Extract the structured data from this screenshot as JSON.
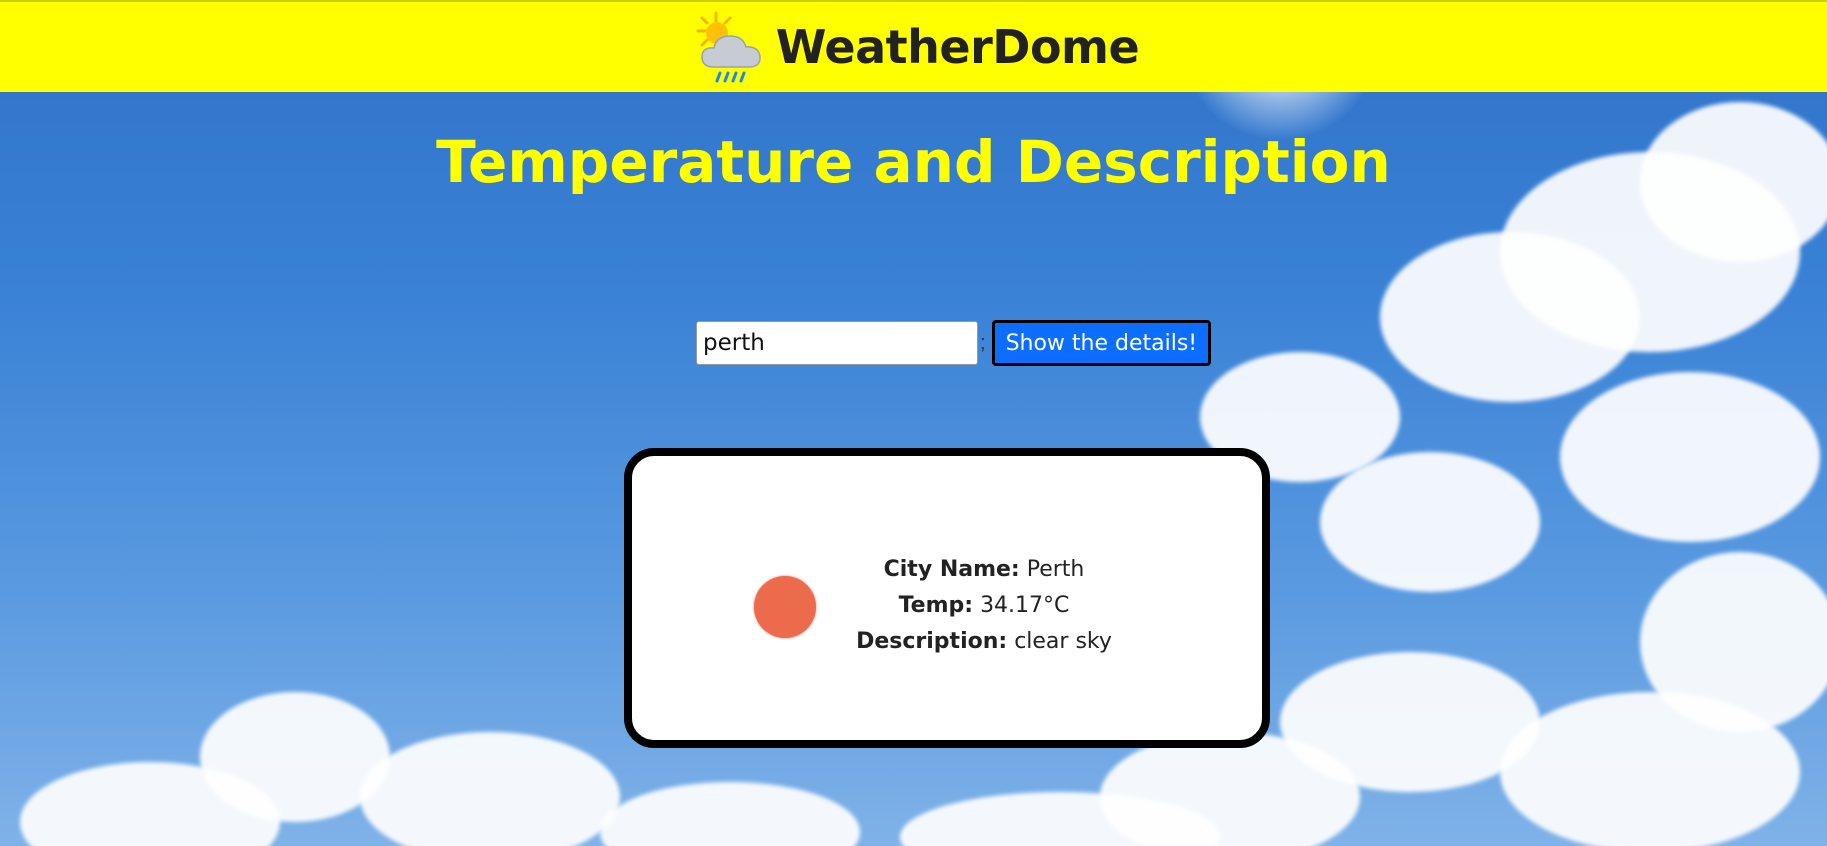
{
  "header": {
    "brand_name": "WeatherDome",
    "logo_icon": "sun-cloud-rain-icon"
  },
  "main": {
    "title": "Temperature and Description",
    "search": {
      "value": "perth",
      "separator": ";",
      "button_label": "Show the details!"
    },
    "result": {
      "weather_icon": "clear-sky-sun-icon",
      "city_label": "City Name:",
      "city_value": "Perth",
      "temp_label": "Temp:",
      "temp_value": "34.17°C",
      "description_label": "Description:",
      "description_value": "clear sky"
    }
  },
  "colors": {
    "header_bg": "#ffff00",
    "title": "#ffff00",
    "button_bg": "#0d6efd",
    "icon_sun": "#ec6b4d"
  }
}
